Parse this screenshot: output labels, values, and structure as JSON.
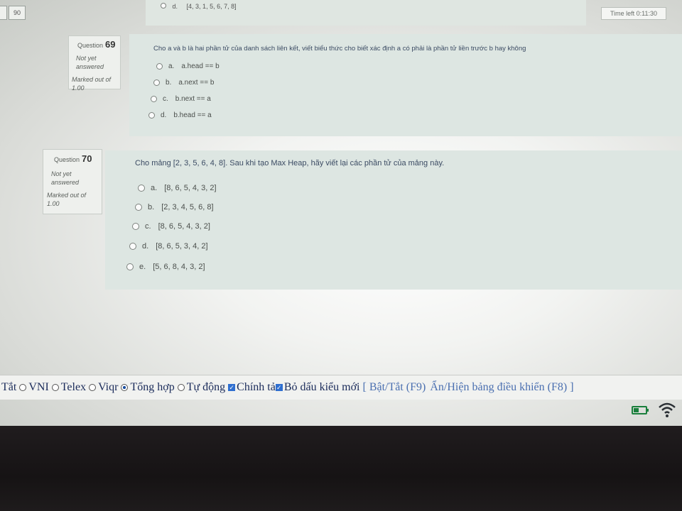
{
  "top": {
    "nav_box_left": "",
    "nav_box_number": "90",
    "prev_option_letter": "d.",
    "prev_option_value": "[4, 3, 1, 5, 6, 7, 8]",
    "timer": "Time left 0:11:30"
  },
  "q69": {
    "label": "Question",
    "number": "69",
    "state": "Not yet answered",
    "mark": "Marked out of 1.00",
    "text": "Cho a và b là hai phần tử của danh sách liên kết, viết biểu thức cho biết xác định a có phải là phần tử liền trước b hay không",
    "options": [
      {
        "letter": "a.",
        "value": "a.head == b"
      },
      {
        "letter": "b.",
        "value": "a.next == b"
      },
      {
        "letter": "c.",
        "value": "b.next == a"
      },
      {
        "letter": "d.",
        "value": "b.head == a"
      }
    ]
  },
  "q70": {
    "label": "Question",
    "number": "70",
    "state": "Not yet answered",
    "mark": "Marked out of 1.00",
    "text": "Cho mảng [2, 3, 5, 6, 4, 8]. Sau khi tạo Max Heap, hãy viết lại các phần tử của mảng này.",
    "options": [
      {
        "letter": "a.",
        "value": "[8, 6, 5, 4, 3, 2]"
      },
      {
        "letter": "b.",
        "value": "[2, 3, 4, 5, 6, 8]"
      },
      {
        "letter": "c.",
        "value": "[8, 6, 5, 4, 3, 2]"
      },
      {
        "letter": "d.",
        "value": "[8, 6, 5, 3, 4, 2]"
      },
      {
        "letter": "e.",
        "value": "[5, 6, 8, 4, 3, 2]"
      }
    ]
  },
  "ime": {
    "tat": "Tắt",
    "vni": "VNI",
    "telex": "Telex",
    "viqr": "Viqr",
    "tong_hop": "Tổng hợp",
    "tu_dong": "Tự động",
    "chinh_ta": "Chính tả",
    "bo_dau": "Bỏ dấu kiểu mới",
    "toggle": "[ Bật/Tắt (F9)",
    "show_hide": "Ẩn/Hiện bảng điều khiển (F8) ]",
    "selected": "tong_hop"
  },
  "colors": {
    "accent": "#1a4fa0",
    "panel": "#dde6e2",
    "question_text": "#3b4b63"
  }
}
